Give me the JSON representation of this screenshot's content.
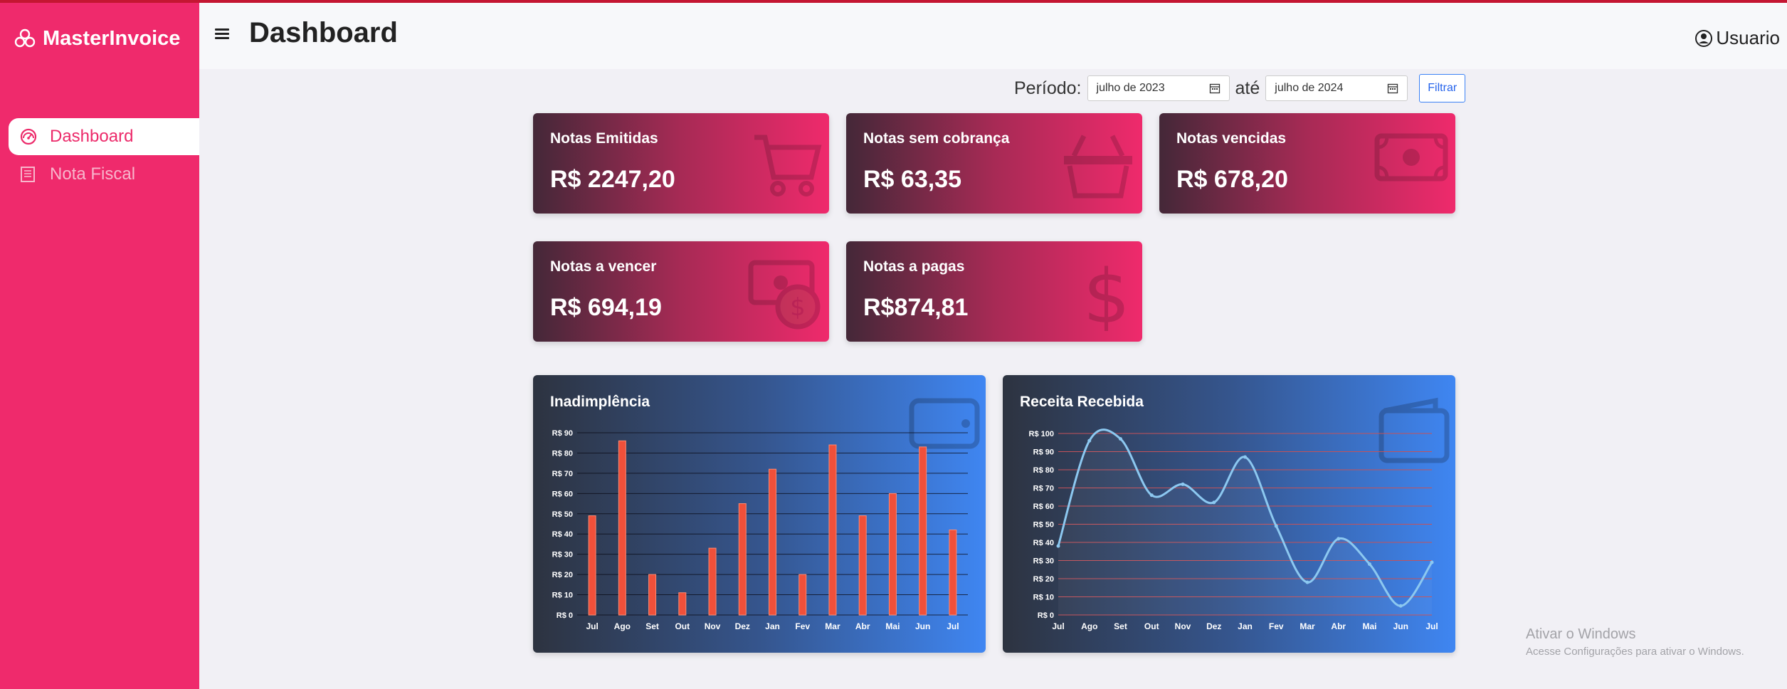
{
  "app": {
    "brand": "MasterInvoice"
  },
  "sidebar": {
    "items": [
      {
        "label": "Dashboard",
        "icon": "gauge-icon"
      },
      {
        "label": "Nota Fiscal",
        "icon": "receipt-icon"
      }
    ]
  },
  "header": {
    "title": "Dashboard",
    "user": "Usuario"
  },
  "filters": {
    "periodo_label": "Período:",
    "start": "julho de 2023",
    "ate_label": "até",
    "end": "julho de 2024",
    "button": "Filtrar"
  },
  "cards": [
    {
      "title": "Notas Emitidas",
      "value": "R$ 2247,20",
      "icon": "cart-icon"
    },
    {
      "title": "Notas sem cobrança",
      "value": "R$ 63,35",
      "icon": "basket-icon"
    },
    {
      "title": "Notas vencidas",
      "value": "R$ 678,20",
      "icon": "cash-icon"
    },
    {
      "title": "Notas a vencer",
      "value": "R$ 694,19",
      "icon": "cash-coin-icon"
    },
    {
      "title": "Notas a pagas",
      "value": "R$874,81",
      "icon": "dollar-icon"
    }
  ],
  "chart_data": [
    {
      "type": "bar",
      "title": "Inadimplência",
      "categories": [
        "Jul",
        "Ago",
        "Set",
        "Out",
        "Nov",
        "Dez",
        "Jan",
        "Fev",
        "Mar",
        "Abr",
        "Mai",
        "Jun",
        "Jul"
      ],
      "values": [
        49,
        86,
        20,
        11,
        33,
        55,
        72,
        20,
        84,
        49,
        60,
        83,
        42
      ],
      "ylim": [
        0,
        90
      ],
      "yticks": [
        "R$ 0",
        "R$ 10",
        "R$ 20",
        "R$ 30",
        "R$ 40",
        "R$ 50",
        "R$ 60",
        "R$ 70",
        "R$ 80",
        "R$ 90"
      ],
      "bar_color": "#f0503a",
      "grid": true
    },
    {
      "type": "line",
      "title": "Receita Recebida",
      "categories": [
        "Jul",
        "Ago",
        "Set",
        "Out",
        "Nov",
        "Dez",
        "Jan",
        "Fev",
        "Mar",
        "Abr",
        "Mai",
        "Jun",
        "Jul"
      ],
      "values": [
        38,
        96,
        97,
        66,
        72,
        62,
        87,
        49,
        18,
        42,
        28,
        5,
        29
      ],
      "ylim": [
        0,
        100
      ],
      "yticks": [
        "R$ 0",
        "R$ 10",
        "R$ 20",
        "R$ 30",
        "R$ 40",
        "R$ 50",
        "R$ 60",
        "R$ 70",
        "R$ 80",
        "R$ 90",
        "R$ 100"
      ],
      "line_color": "#8cc8f0",
      "grid_color": "#c4525a",
      "grid": true
    }
  ],
  "watermark": {
    "line1": "Ativar o Windows",
    "line2": "Acesse Configurações para ativar o Windows."
  },
  "colors": {
    "sidebar": "#ef2a6c",
    "accent": "#ec2a6a",
    "chart_blue": "#3f86f2"
  }
}
